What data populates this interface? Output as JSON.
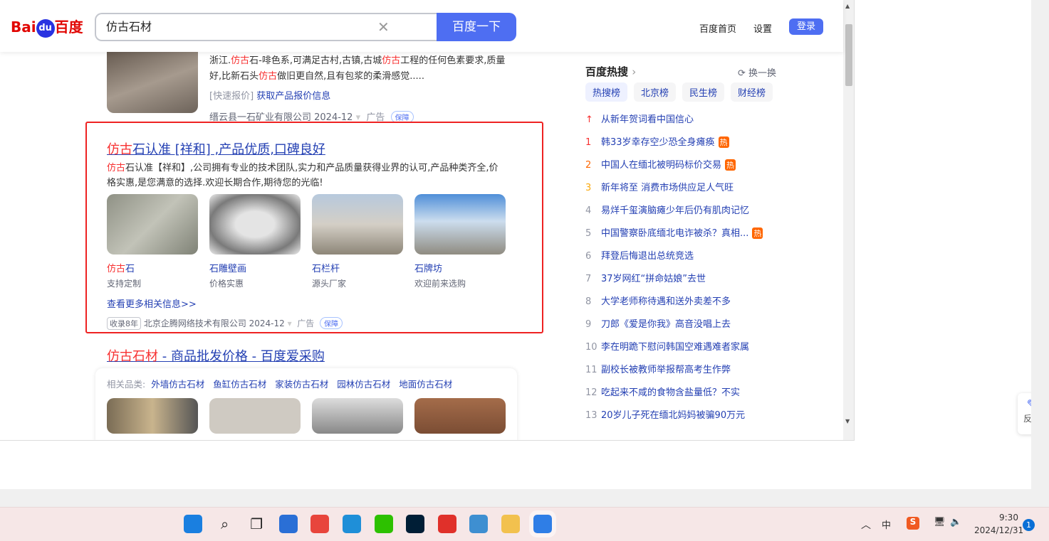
{
  "header": {
    "logo": "Bai du 百度",
    "logo_a": "Bai",
    "logo_b": "du",
    "logo_c": "百度",
    "query": "仿古石材",
    "search_button": "百度一下",
    "links": [
      "百度首页",
      "设置"
    ],
    "login": "登录"
  },
  "result1": {
    "desc_parts": [
      "浙江.",
      "仿古",
      "石-啡色系,可满足古村,古镇,古城",
      "仿古",
      "工程的任何色素要求,质量"
    ],
    "desc2_parts": [
      "好,比新石头",
      "仿古",
      "做旧更自然,且有包浆的柔滑感觉....."
    ],
    "quick_label": "[快速报价]",
    "quick_link": "获取产品报价信息",
    "source": "缙云县一石矿业有限公司 2024-12",
    "ad": "广告",
    "guarantee": "保障"
  },
  "result2": {
    "title_hl": "仿古",
    "title_rest": "石认准 [祥和] ,产品优质,口碑良好",
    "desc_hl": "仿古",
    "desc1": "石认准【祥和】,公司拥有专业的技术团队,实力和产品质量获得业界的认可,产品种类齐全,价",
    "desc2": "格实惠,是您满意的选择.欢迎长期合作,期待您的光临!",
    "products": [
      {
        "hl": "仿古",
        "name": "石",
        "sub": "支持定制"
      },
      {
        "hl": "",
        "name": "石雕壁画",
        "sub": "价格实惠"
      },
      {
        "hl": "",
        "name": "石栏杆",
        "sub": "源头厂家"
      },
      {
        "hl": "",
        "name": "石牌坊",
        "sub": "欢迎前来选购"
      }
    ],
    "more": "查看更多相关信息>>",
    "years": "收录8年",
    "source": "北京企腾网络技术有限公司 2024-12",
    "ad": "广告",
    "guarantee": "保障"
  },
  "result3": {
    "title_hl": "仿古石材",
    "title_rest": " - 商品批发价格 - 百度爱采购",
    "cat_label": "相关品类:",
    "cats": [
      "外墙仿古石材",
      "鱼缸仿古石材",
      "家装仿古石材",
      "园林仿古石材",
      "地面仿古石材"
    ]
  },
  "hot": {
    "title": "百度热搜",
    "refresh": "换一换",
    "tabs": [
      "热搜榜",
      "北京榜",
      "民生榜",
      "财经榜"
    ],
    "items": [
      {
        "rank": "↑",
        "text": "从新年贺词看中国信心",
        "fire": ""
      },
      {
        "rank": "1",
        "text": "韩33岁幸存空少恐全身瘫痪",
        "fire": "热"
      },
      {
        "rank": "2",
        "text": "中国人在缅北被明码标价交易",
        "fire": "热"
      },
      {
        "rank": "3",
        "text": "新年将至 消费市场供应足人气旺",
        "fire": ""
      },
      {
        "rank": "4",
        "text": "易烊千玺演脑瘫少年后仍有肌肉记忆",
        "fire": ""
      },
      {
        "rank": "5",
        "text": "中国警察卧底缅北电诈被杀？真相...",
        "fire": "热"
      },
      {
        "rank": "6",
        "text": "拜登后悔退出总统竞选",
        "fire": ""
      },
      {
        "rank": "7",
        "text": "37岁网红“拼命姑娘”去世",
        "fire": ""
      },
      {
        "rank": "8",
        "text": "大学老师称待遇和送外卖差不多",
        "fire": ""
      },
      {
        "rank": "9",
        "text": "刀郎《爱是你我》高音没唱上去",
        "fire": ""
      },
      {
        "rank": "10",
        "text": "李在明跪下慰问韩国空难遇难者家属",
        "fire": ""
      },
      {
        "rank": "11",
        "text": "副校长被教师举报帮高考生作弊",
        "fire": ""
      },
      {
        "rank": "12",
        "text": "吃起来不咸的食物含盐量低？不实",
        "fire": ""
      },
      {
        "rank": "13",
        "text": "20岁儿子死在缅北妈妈被骗90万元",
        "fire": ""
      }
    ],
    "rank_colors": [
      "#f73131",
      "#f73131",
      "#ff6600",
      "#faa90e"
    ]
  },
  "feedback": "反馈",
  "taskbar": {
    "time": "9:30",
    "date": "2024/12/31",
    "ime": "中",
    "notifications": "1",
    "apps": [
      "windows-start",
      "search",
      "task-view",
      "widgets",
      "chrome",
      "edge",
      "wechat",
      "photoshop",
      "wps",
      "notepad",
      "file-explorer",
      "browser"
    ]
  }
}
